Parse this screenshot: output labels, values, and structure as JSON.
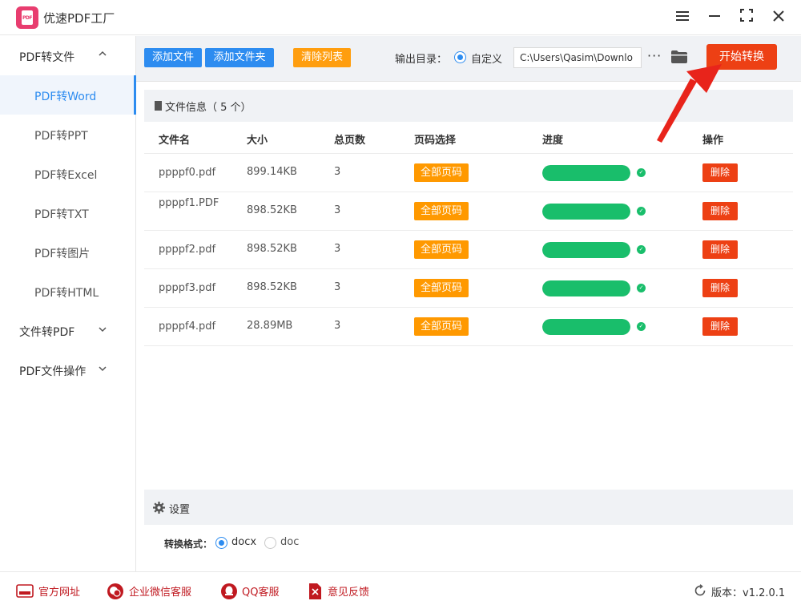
{
  "app": {
    "title": "优速PDF工厂",
    "logo_text": "PDF"
  },
  "window_controls": {
    "menu": "menu-icon",
    "minimize": "minimize-icon",
    "maximize": "maximize-icon",
    "close": "close-icon"
  },
  "sidebar": {
    "groups": [
      {
        "label": "PDF转文件",
        "chevron": "chevron-up-icon",
        "expanded": true
      },
      {
        "label": "文件转PDF",
        "chevron": "chevron-down-icon",
        "expanded": false
      },
      {
        "label": "PDF文件操作",
        "chevron": "chevron-down-icon",
        "expanded": false
      }
    ],
    "items": [
      {
        "label": "PDF转Word",
        "active": true
      },
      {
        "label": "PDF转PPT",
        "active": false
      },
      {
        "label": "PDF转Excel",
        "active": false
      },
      {
        "label": "PDF转TXT",
        "active": false
      },
      {
        "label": "PDF转图片",
        "active": false
      },
      {
        "label": "PDF转HTML",
        "active": false
      }
    ]
  },
  "toolbar": {
    "add_file": "添加文件",
    "add_folder": "添加文件夹",
    "clear_list": "清除列表",
    "output_label": "输出目录：",
    "custom_option": "自定义",
    "output_path": "C:\\Users\\Qasim\\Downlo",
    "more": "···",
    "start": "开始转换",
    "colors": {
      "blue": "#2d8cf0",
      "orange": "#ff9e0f",
      "red": "#ed4014"
    }
  },
  "file_panel": {
    "title": "文件信息（ 5 个）",
    "columns": [
      "文件名",
      "大小",
      "总页数",
      "页码选择",
      "进度",
      "操作"
    ],
    "rows": [
      {
        "name": "ppppf0.pdf",
        "size": "899.14KB",
        "pages": "3",
        "page_select": "全部页码",
        "progress": 1.0,
        "action": "删除"
      },
      {
        "name": "ppppf1.PDF",
        "size": "898.52KB",
        "pages": "3",
        "page_select": "全部页码",
        "progress": 1.0,
        "action": "删除"
      },
      {
        "name": "ppppf2.pdf",
        "size": "898.52KB",
        "pages": "3",
        "page_select": "全部页码",
        "progress": 1.0,
        "action": "删除"
      },
      {
        "name": "ppppf3.pdf",
        "size": "898.52KB",
        "pages": "3",
        "page_select": "全部页码",
        "progress": 1.0,
        "action": "删除"
      },
      {
        "name": "ppppf4.pdf",
        "size": "28.89MB",
        "pages": "3",
        "page_select": "全部页码",
        "progress": 1.0,
        "action": "删除"
      }
    ],
    "progress_color": "#19be6b"
  },
  "settings": {
    "title": "设置",
    "format_label": "转换格式：",
    "options": [
      {
        "label": "docx",
        "selected": true
      },
      {
        "label": "doc",
        "selected": false
      }
    ]
  },
  "footer": {
    "links": [
      {
        "label": "官方网址",
        "icon": "website-icon"
      },
      {
        "label": "企业微信客服",
        "icon": "wechat-icon"
      },
      {
        "label": "QQ客服",
        "icon": "qq-icon"
      },
      {
        "label": "意见反馈",
        "icon": "feedback-icon"
      }
    ],
    "version": "版本：v1.2.0.1"
  }
}
